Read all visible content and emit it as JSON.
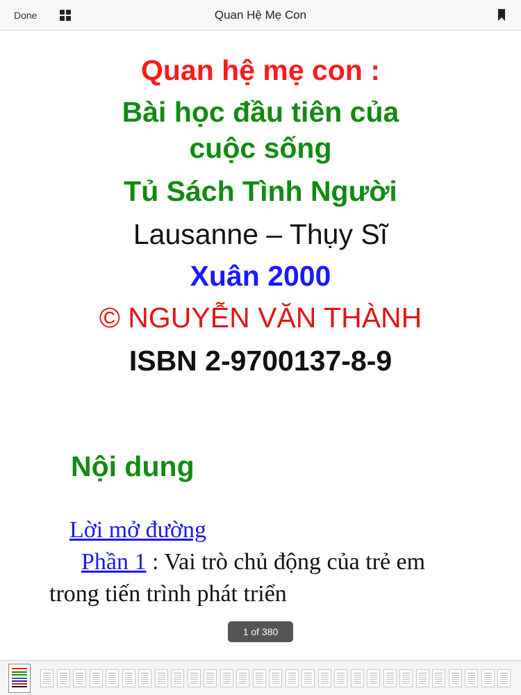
{
  "toolbar": {
    "done_label": "Done",
    "title": "Quan Hệ Mẹ Con",
    "icons": [
      "grid-icon",
      "bookmark-icon"
    ]
  },
  "page": {
    "title_line1": "Quan hệ mẹ con :",
    "title_line2": "Bài học đầu tiên của",
    "title_line3": "cuộc sống",
    "series": "Tủ Sách Tình Người",
    "location": "Lausanne – Thụy Sĩ",
    "date": "Xuân 2000",
    "copyright": "© NGUYỄN VĂN THÀNH",
    "isbn": "ISBN 2-9700137-8-9",
    "toc_heading": "Nội dung",
    "toc": [
      {
        "link": "Lời mở đường",
        "text": ""
      },
      {
        "link": "Phần 1",
        "text": " : Vai trò chủ động của trẻ em"
      }
    ],
    "toc_continuation": "trong tiến trình phát triển"
  },
  "page_indicator": "1 of 380",
  "colors": {
    "red": "#ff1a1a",
    "green": "#138a13",
    "blue": "#1a1aff",
    "link": "#1a1aee"
  }
}
